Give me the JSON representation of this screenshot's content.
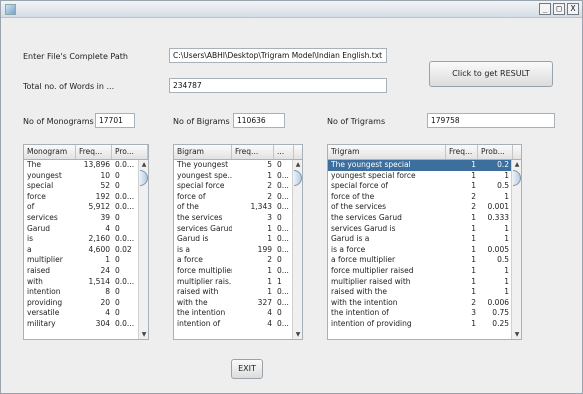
{
  "window": {
    "title": "",
    "controls": [
      "_",
      "□",
      "X"
    ]
  },
  "form": {
    "path_label": "Enter File's Complete Path",
    "path_value": "C:\\Users\\ABHI\\Desktop\\Trigram Model\\Indian English.txt",
    "total_label": "Total no. of Words in ...",
    "total_value": "234787",
    "result_button": "Click to get RESULT",
    "mono_label": "No of Monograms",
    "mono_value": "17701",
    "bi_label": "No of Bigrams",
    "bi_value": "110636",
    "tri_label": "No of Trigrams",
    "tri_value": "179758",
    "exit_button": "EXIT"
  },
  "monogram_table": {
    "headers": [
      "Monogram",
      "Freq...",
      "Pro..."
    ],
    "rows": [
      [
        "The",
        "13,896",
        "0.0..."
      ],
      [
        "youngest",
        "10",
        "0"
      ],
      [
        "special",
        "52",
        "0"
      ],
      [
        "force",
        "192",
        "0.0..."
      ],
      [
        "of",
        "5,912",
        "0.0..."
      ],
      [
        "services",
        "39",
        "0"
      ],
      [
        "Garud",
        "4",
        "0"
      ],
      [
        "is",
        "2,160",
        "0.0..."
      ],
      [
        "a",
        "4,600",
        "0.02"
      ],
      [
        "multiplier",
        "1",
        "0"
      ],
      [
        "raised",
        "24",
        "0"
      ],
      [
        "with",
        "1,514",
        "0.0..."
      ],
      [
        "intention",
        "8",
        "0"
      ],
      [
        "providing",
        "20",
        "0"
      ],
      [
        "versatile",
        "4",
        "0"
      ],
      [
        "military",
        "304",
        "0.0..."
      ]
    ]
  },
  "bigram_table": {
    "headers": [
      "Bigram",
      "Freq...",
      "..."
    ],
    "rows": [
      [
        "The youngest",
        "5",
        "0"
      ],
      [
        "youngest spe...",
        "1",
        "0..."
      ],
      [
        "special force",
        "2",
        "0..."
      ],
      [
        "force of",
        "2",
        "0..."
      ],
      [
        "of the",
        "1,343",
        "0..."
      ],
      [
        "the services",
        "3",
        "0"
      ],
      [
        "services Garud",
        "1",
        "0..."
      ],
      [
        "Garud is",
        "1",
        "0..."
      ],
      [
        "is a",
        "199",
        "0..."
      ],
      [
        "a force",
        "2",
        "0"
      ],
      [
        "force multiplier",
        "1",
        "0..."
      ],
      [
        "multiplier rais...",
        "1",
        "1"
      ],
      [
        "raised with",
        "1",
        "0..."
      ],
      [
        "with the",
        "327",
        "0..."
      ],
      [
        "the intention",
        "4",
        "0"
      ],
      [
        "intention of",
        "4",
        "0..."
      ]
    ]
  },
  "trigram_table": {
    "headers": [
      "Trigram",
      "Freq...",
      "Prob..."
    ],
    "rows": [
      [
        "The youngest special",
        "1",
        "0.2"
      ],
      [
        "youngest special force",
        "1",
        "1"
      ],
      [
        "special force of",
        "1",
        "0.5"
      ],
      [
        "force of the",
        "2",
        "1"
      ],
      [
        "of the services",
        "2",
        "0.001"
      ],
      [
        "the services Garud",
        "1",
        "0.333"
      ],
      [
        "services Garud is",
        "1",
        "1"
      ],
      [
        "Garud is a",
        "1",
        "1"
      ],
      [
        "is a force",
        "1",
        "0.005"
      ],
      [
        "a force multiplier",
        "1",
        "0.5"
      ],
      [
        "force multiplier raised",
        "1",
        "1"
      ],
      [
        "multiplier raised with",
        "1",
        "1"
      ],
      [
        "raised with the",
        "1",
        "1"
      ],
      [
        "with the intention",
        "2",
        "0.006"
      ],
      [
        "the intention of",
        "3",
        "0.75"
      ],
      [
        "intention of providing",
        "1",
        "0.25"
      ]
    ],
    "selected_row": 0
  },
  "colors": {
    "selection": "#3d6f9e",
    "window_bg": "#eeeeee"
  },
  "icons": {
    "app": "java-cup-icon",
    "scroll_up": "arrow-up-icon",
    "scroll_down": "arrow-down-icon"
  }
}
